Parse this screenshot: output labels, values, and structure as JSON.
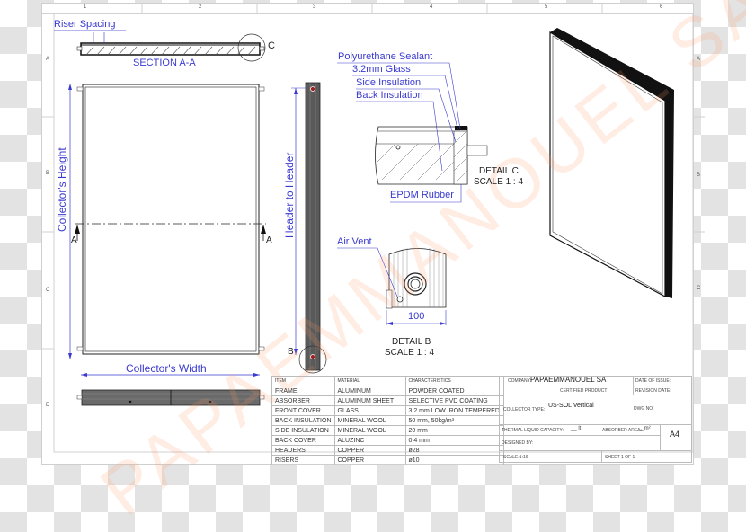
{
  "sheet": {
    "column_zones": [
      "1",
      "2",
      "3",
      "4",
      "5",
      "6"
    ],
    "row_zones": [
      "A",
      "B",
      "C",
      "D"
    ],
    "watermark": "PAPAEMMANOUEL SA"
  },
  "views": {
    "section_aa": {
      "title": "SECTION A-A",
      "label_riser": "Riser Spacing",
      "detail_marker": "C"
    },
    "front": {
      "label_height": "Collector's Height",
      "label_width": "Collector's Width",
      "section_marker_left": "A",
      "section_marker_right": "A"
    },
    "side": {
      "label_header": "Header to Header",
      "detail_marker": "B"
    },
    "detail_c": {
      "title": "DETAIL C",
      "scale": "SCALE 1 : 4",
      "callouts": [
        "Polyurethane Sealant",
        "3.2mm Glass",
        "Side Insulation",
        "Back Insulation",
        "EPDM Rubber"
      ]
    },
    "detail_b": {
      "title": "DETAIL B",
      "scale": "SCALE 1 : 4",
      "callout": "Air Vent",
      "dimension": "100"
    }
  },
  "bom": {
    "headers": [
      "ITEM",
      "MATERIAL",
      "CHARACTERISTICS"
    ],
    "rows": [
      [
        "FRAME",
        "ALUMINUM",
        "POWDER COATED"
      ],
      [
        "ABSORBER",
        "ALUMINUM SHEET",
        "SELECTIVE PVD COATING"
      ],
      [
        "FRONT COVER",
        "GLASS",
        "3.2 mm LOW IRON TEMPERED"
      ],
      [
        "BACK INSULATION",
        "MINERAL WOOL",
        "50 mm, 50kg/m³"
      ],
      [
        "SIDE INSULATION",
        "MINERAL WOOL",
        "20 mm"
      ],
      [
        "BACK COVER",
        "ALUZINC",
        "0.4 mm"
      ],
      [
        "HEADERS",
        "COPPER",
        "ø28"
      ],
      [
        "RISERS",
        "COPPER",
        "ø10"
      ]
    ]
  },
  "title_block": {
    "company_label": "COMPANY:",
    "company": "PAPAEMMANOUEL SA",
    "date_issue_label": "DATE OF ISSUE:",
    "certified": "CERTIFIED PRODUCT",
    "revision_label": "REVISION DATE:",
    "collector_type_label": "COLLECTOR TYPE:",
    "collector_type": "US-SOL  Vertical",
    "dwg_label": "DWG NO.",
    "thermal_label": "THERMAL LIQUID CAPACITY:",
    "thermal_value": "__ lt",
    "absorber_label": "ABSORBER AREA:",
    "absorber_value": "__m²",
    "size": "A4",
    "designed_label": "DESIGNED BY:",
    "scale": "SCALE:1:16",
    "sheet": "SHEET 1 OF 1"
  }
}
